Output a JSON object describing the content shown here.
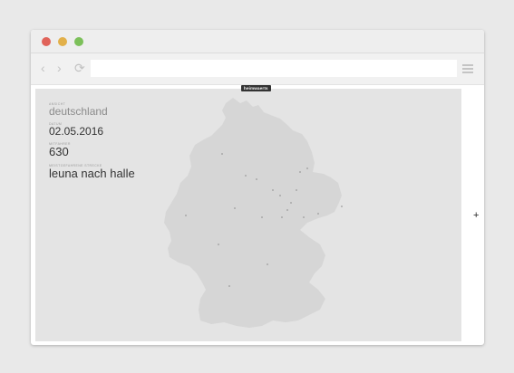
{
  "tooltip": {
    "text": "heimwaerts"
  },
  "browser": {
    "back_icon": "chevron-left-icon",
    "forward_icon": "chevron-right-icon",
    "reload_icon": "reload-icon",
    "url": "",
    "menu_icon": "hamburger-menu-icon"
  },
  "info": {
    "country_label": "Ansicht",
    "country": "deutschland",
    "date_label": "Datum",
    "date": "02.05.2016",
    "count_label": "Mitfahrer",
    "count": "630",
    "route_label": "Meistgefahrene Strecke",
    "route": "leuna nach halle"
  },
  "zoom": {
    "plus": "+"
  },
  "colors": {
    "map_fill": "#d6d6d6",
    "background": "#e4e4e4",
    "dot": "#9a9a9a"
  }
}
